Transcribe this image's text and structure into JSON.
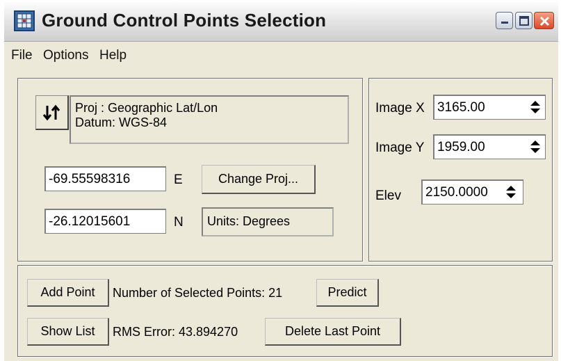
{
  "window": {
    "title": "Ground Control Points Selection"
  },
  "menu": {
    "file": "File",
    "options": "Options",
    "help": "Help"
  },
  "projection": {
    "proj_line": "Proj : Geographic Lat/Lon",
    "datum_line": "Datum: WGS-84",
    "lon_value": "-69.55598316",
    "lon_unit": "E",
    "lat_value": "-26.12015601",
    "lat_unit": "N",
    "change_proj_label": "Change Proj...",
    "units_label": "Units: Degrees"
  },
  "image_coords": {
    "image_x_label": "Image X",
    "image_x_value": "3165.00",
    "image_y_label": "Image Y",
    "image_y_value": "1959.00",
    "elev_label": "Elev",
    "elev_value": "2150.0000"
  },
  "points": {
    "add_point_label": "Add Point",
    "selected_count_text": "Number of Selected Points: 21",
    "predict_label": "Predict",
    "show_list_label": "Show List",
    "rms_error_text": "RMS Error: 43.894270",
    "delete_last_label": "Delete Last Point"
  },
  "icons": {
    "app": "map-grid-icon",
    "swap": "swap-arrows-icon",
    "spinner": "up-down-spinner-icon",
    "minimize": "minimize-icon",
    "maximize": "maximize-icon",
    "close": "close-icon"
  },
  "colors": {
    "window_bg": "#ece9d8",
    "close_button": "#d9482a"
  }
}
